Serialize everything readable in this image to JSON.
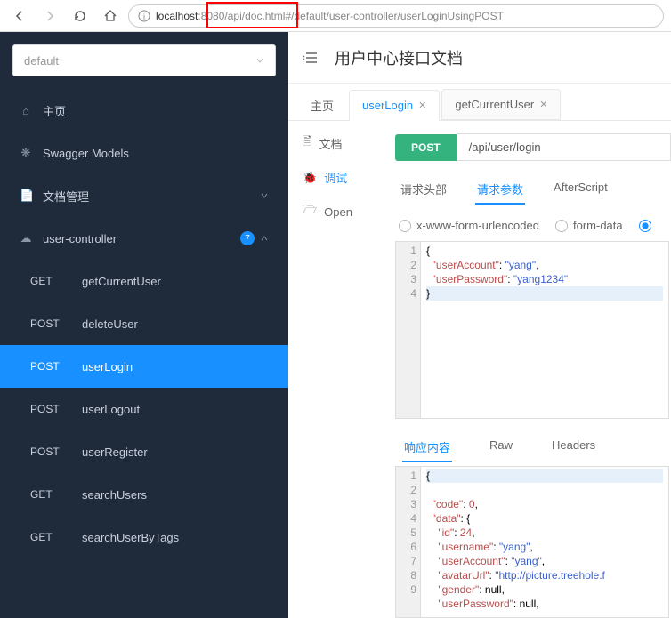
{
  "browser": {
    "url_prefix": "localhost",
    "url_port": ":8080/",
    "url_rest": "api/doc.html#/default/user-controller/userLoginUsingPOST"
  },
  "sidebar": {
    "spec": "default",
    "items": [
      {
        "icon": "home",
        "label": "主页"
      },
      {
        "icon": "swagger",
        "label": "Swagger Models"
      },
      {
        "icon": "doc",
        "label": "文档管理",
        "expandable": true
      },
      {
        "icon": "cloud",
        "label": "user-controller",
        "badge": "7",
        "open": true
      }
    ],
    "endpoints": [
      {
        "method": "GET",
        "label": "getCurrentUser"
      },
      {
        "method": "POST",
        "label": "deleteUser"
      },
      {
        "method": "POST",
        "label": "userLogin",
        "active": true
      },
      {
        "method": "POST",
        "label": "userLogout"
      },
      {
        "method": "POST",
        "label": "userRegister"
      },
      {
        "method": "GET",
        "label": "searchUsers"
      },
      {
        "method": "GET",
        "label": "searchUserByTags"
      }
    ]
  },
  "header": {
    "title": "用户中心接口文档"
  },
  "tabs": [
    {
      "label": "主页"
    },
    {
      "label": "userLogin",
      "closable": true,
      "active": true
    },
    {
      "label": "getCurrentUser",
      "closable": true
    }
  ],
  "leftPanel": [
    {
      "icon": "doc",
      "label": "文档"
    },
    {
      "icon": "bug",
      "label": "调试",
      "active": true
    },
    {
      "icon": "open",
      "label": "Open"
    }
  ],
  "api": {
    "method": "POST",
    "path": "/api/user/login"
  },
  "reqTabs": [
    {
      "label": "请求头部"
    },
    {
      "label": "请求参数",
      "active": true
    },
    {
      "label": "AfterScript"
    }
  ],
  "bodyTypes": [
    {
      "label": "x-www-form-urlencoded",
      "checked": false
    },
    {
      "label": "form-data",
      "checked": false
    },
    {
      "label": "",
      "checked": true
    }
  ],
  "reqBody": {
    "lines": [
      "1",
      "2",
      "3",
      "4"
    ],
    "l1": "{",
    "l2": "  \"userAccount\": \"yang\",",
    "l3": "  \"userPassword\": \"yang1234\"",
    "l4": "}"
  },
  "respTabs": [
    {
      "label": "响应内容",
      "active": true
    },
    {
      "label": "Raw"
    },
    {
      "label": "Headers"
    }
  ],
  "respBody": {
    "lines": [
      "1",
      "2",
      "3",
      "4",
      "5",
      "6",
      "7",
      "8",
      "9"
    ],
    "text": "{\n  \"code\": 0,\n  \"data\": {\n    \"id\": 24,\n    \"username\": \"yang\",\n    \"userAccount\": \"yang\",\n    \"avatarUrl\": \"http://picture.treehole.f\n    \"gender\": null,\n    \"userPassword\": null,"
  }
}
